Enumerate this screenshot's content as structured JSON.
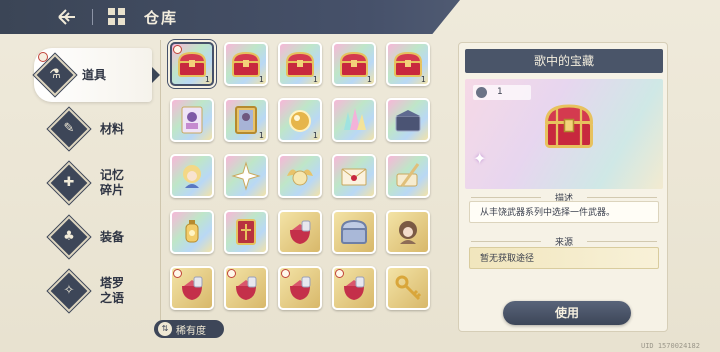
{
  "header": {
    "title": "仓库"
  },
  "nav": [
    {
      "label": "道具",
      "icon": "potion-icon",
      "active": true
    },
    {
      "label": "材料",
      "icon": "scroll-icon",
      "active": false
    },
    {
      "label": "记忆\n碎片",
      "icon": "puzzle-icon",
      "active": false
    },
    {
      "label": "装备",
      "icon": "ribbon-icon",
      "active": false
    },
    {
      "label": "塔罗\n之语",
      "icon": "tarot-icon",
      "active": false
    }
  ],
  "items": [
    {
      "name": "treasure-chest-red",
      "quality": "rainbow",
      "count": "1",
      "selected": true,
      "timer": true
    },
    {
      "name": "treasure-chest-red",
      "quality": "rainbow",
      "count": "1",
      "selected": false,
      "timer": false
    },
    {
      "name": "treasure-chest-red",
      "quality": "rainbow",
      "count": "1",
      "selected": false,
      "timer": false
    },
    {
      "name": "treasure-chest-red",
      "quality": "rainbow",
      "count": "1",
      "selected": false,
      "timer": false
    },
    {
      "name": "treasure-chest-red",
      "quality": "rainbow",
      "count": "1",
      "selected": false,
      "timer": false
    },
    {
      "name": "photo-card",
      "quality": "rainbow",
      "count": "",
      "selected": false,
      "timer": false
    },
    {
      "name": "framed-portrait",
      "quality": "rainbow",
      "count": "1",
      "selected": false,
      "timer": false
    },
    {
      "name": "golden-orb",
      "quality": "rainbow",
      "count": "1",
      "selected": false,
      "timer": false
    },
    {
      "name": "crystal-cluster",
      "quality": "rainbow",
      "count": "",
      "selected": false,
      "timer": false
    },
    {
      "name": "dark-chest",
      "quality": "rainbow",
      "count": "",
      "selected": false,
      "timer": false
    },
    {
      "name": "character-portrait-blonde",
      "quality": "rainbow",
      "count": "",
      "selected": false,
      "timer": false
    },
    {
      "name": "star-emblem",
      "quality": "rainbow",
      "count": "",
      "selected": false,
      "timer": false
    },
    {
      "name": "winged-orb",
      "quality": "rainbow",
      "count": "",
      "selected": false,
      "timer": false
    },
    {
      "name": "sealed-letter",
      "quality": "rainbow",
      "count": "",
      "selected": false,
      "timer": false
    },
    {
      "name": "quill-scroll",
      "quality": "rainbow",
      "count": "",
      "selected": false,
      "timer": false
    },
    {
      "name": "golden-lantern",
      "quality": "rainbow",
      "count": "",
      "selected": false,
      "timer": false
    },
    {
      "name": "red-book",
      "quality": "rainbow",
      "count": "",
      "selected": false,
      "timer": false
    },
    {
      "name": "red-gem-pouch",
      "quality": "gold",
      "count": "",
      "selected": false,
      "timer": false
    },
    {
      "name": "silver-chest",
      "quality": "gold",
      "count": "",
      "selected": false,
      "timer": false
    },
    {
      "name": "character-portrait-brunette",
      "quality": "gold",
      "count": "",
      "selected": false,
      "timer": false
    },
    {
      "name": "red-gem-pouch",
      "quality": "gold",
      "count": "",
      "selected": false,
      "timer": true
    },
    {
      "name": "red-gem-pouch",
      "quality": "gold",
      "count": "",
      "selected": false,
      "timer": true
    },
    {
      "name": "red-gem-pouch",
      "quality": "gold",
      "count": "",
      "selected": false,
      "timer": true
    },
    {
      "name": "red-gem-pouch",
      "quality": "gold",
      "count": "",
      "selected": false,
      "timer": true
    },
    {
      "name": "golden-key",
      "quality": "gold",
      "count": "",
      "selected": false,
      "timer": false
    }
  ],
  "rarity_label": "稀有度",
  "detail": {
    "title": "歌中的宝藏",
    "owned": "1",
    "desc_label": "描述",
    "desc": "从丰饶武器系列中选择一件武器。",
    "source_label": "来源",
    "source": "暂无获取途径",
    "use_label": "使用"
  },
  "uid": "UID 1570024182",
  "colors": {
    "panel_dark": "#3d4658",
    "accent_red": "#c0443a",
    "gold": "#d8b86a"
  }
}
